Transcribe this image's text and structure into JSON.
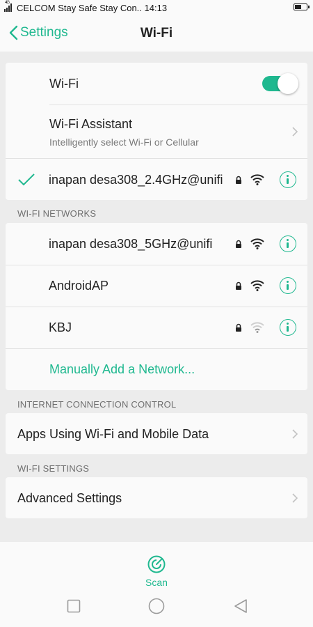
{
  "status_bar": {
    "signal_text": "4G",
    "carrier_time": "CELCOM Stay Safe Stay Con.. 14:13"
  },
  "header": {
    "back_label": "Settings",
    "title": "Wi-Fi"
  },
  "wifi_card": {
    "wifi_label": "Wi-Fi",
    "wifi_enabled": true,
    "assistant_title": "Wi-Fi Assistant",
    "assistant_subtitle": "Intelligently select Wi-Fi or Cellular",
    "connected_network": "inapan desa308_2.4GHz@unifi"
  },
  "networks": {
    "header": "WI-FI NETWORKS",
    "items": [
      {
        "name": "inapan desa308_5GHz@unifi",
        "secured": true,
        "signal": "strong"
      },
      {
        "name": "AndroidAP",
        "secured": true,
        "signal": "strong"
      },
      {
        "name": "KBJ",
        "secured": true,
        "signal": "weak"
      }
    ],
    "manual_add": "Manually Add a Network..."
  },
  "internet_control": {
    "header": "INTERNET CONNECTION CONTROL",
    "apps_label": "Apps Using Wi-Fi and Mobile Data"
  },
  "wifi_settings": {
    "header": "WI-FI SETTINGS",
    "advanced_label": "Advanced Settings"
  },
  "bottom": {
    "scan_label": "Scan"
  },
  "colors": {
    "accent": "#1fb88f",
    "background": "#ececec",
    "card": "#fafafa"
  },
  "icons": {
    "back": "chevron-left-icon",
    "check": "checkmark-icon",
    "lock": "lock-icon",
    "wifi": "wifi-signal-icon",
    "info": "info-icon",
    "chevron": "chevron-right-icon",
    "scan": "radar-scan-icon"
  }
}
